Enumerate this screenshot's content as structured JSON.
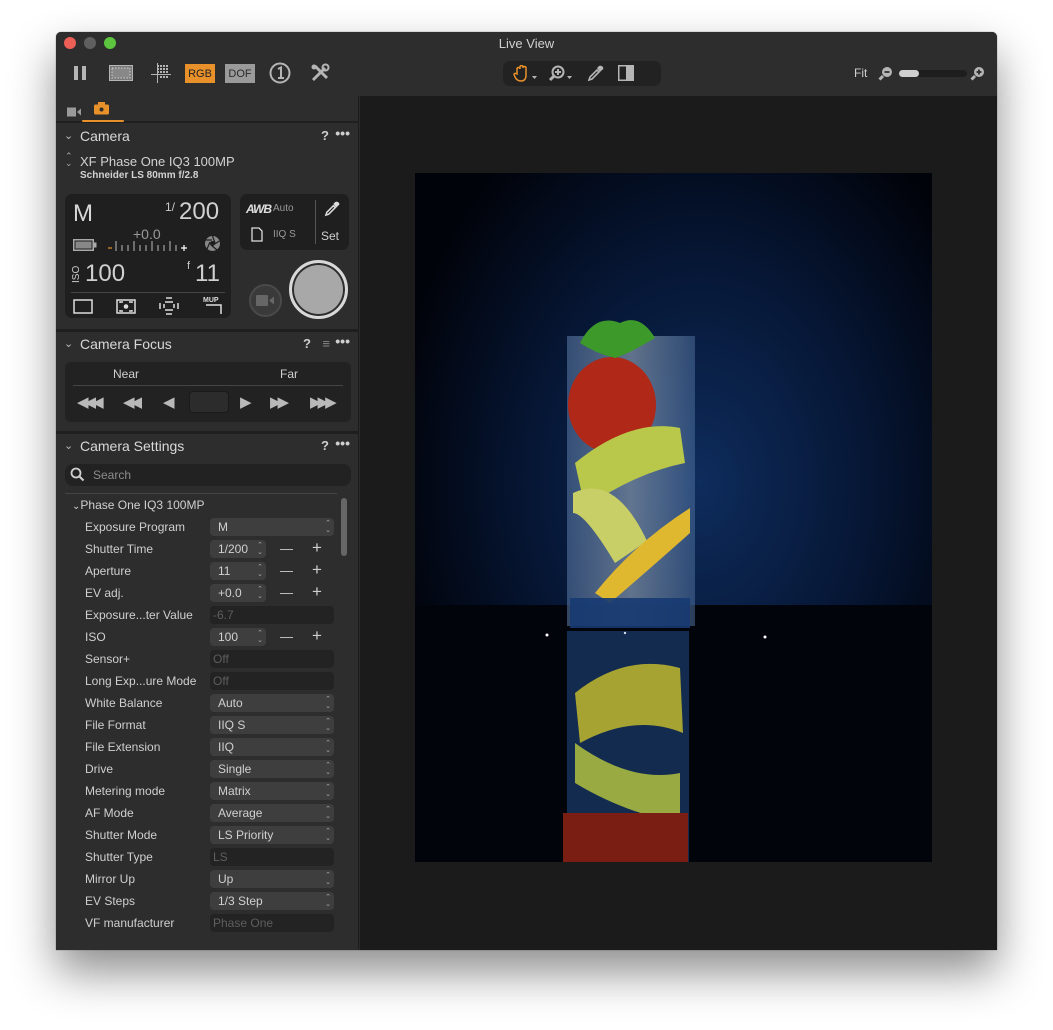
{
  "window": {
    "title": "Live View"
  },
  "toolbar": {
    "left_buttons": [
      {
        "name": "pause",
        "icon": "pause-icon"
      },
      {
        "name": "frame",
        "icon": "frame-overlay-icon"
      },
      {
        "name": "grid",
        "icon": "grid-icon"
      },
      {
        "name": "rgb",
        "label": "RGB"
      },
      {
        "name": "dof",
        "label": "DOF"
      },
      {
        "name": "one",
        "icon": "circled-one-icon"
      },
      {
        "name": "tools",
        "icon": "tools-icon"
      }
    ],
    "rgb_label": "RGB",
    "dof_label": "DOF",
    "center_tools": [
      "hand-icon",
      "zoom-in-icon",
      "eyedropper-icon",
      "compare-icon"
    ],
    "fit_label": "Fit",
    "zoom_level_fraction": 0.3
  },
  "colors": {
    "accent": "#e8912a",
    "panel": "#2d2d2d",
    "viewer": "#1b1b1b"
  },
  "tabs": [
    {
      "icon": "video-icon",
      "active": false
    },
    {
      "icon": "camera-icon",
      "active": true
    }
  ],
  "camera": {
    "section_title": "Camera",
    "help": "?",
    "more": "•••",
    "model": "XF Phase One IQ3 100MP",
    "lens": "Schneider LS 80mm f/2.8",
    "lcd": {
      "mode": "M",
      "shutter_prefix": "1/",
      "shutter": "200",
      "ev": "+0.0",
      "ev_minus": "–",
      "ev_plus": "+",
      "iso_label": "ISO",
      "iso": "100",
      "aperture_prefix": "f",
      "aperture": "11",
      "mup_label": "MUP"
    },
    "wb": {
      "awb_label": "AWB",
      "wb_value": "Auto",
      "file_format": "IIQ S",
      "set_label": "Set"
    }
  },
  "focus": {
    "section_title": "Camera Focus",
    "help": "?",
    "more": "•••",
    "near_label": "Near",
    "far_label": "Far",
    "buttons": [
      "◀◀◀",
      "◀◀",
      "◀",
      "▶",
      "▶▶",
      "▶▶▶"
    ]
  },
  "settings": {
    "section_title": "Camera Settings",
    "help": "?",
    "more": "•••",
    "search_placeholder": "Search",
    "group": "Phase One IQ3 100MP",
    "rows": [
      {
        "label": "Exposure Program",
        "value": "M",
        "type": "select"
      },
      {
        "label": "Shutter Time",
        "value": "1/200",
        "type": "stepper"
      },
      {
        "label": "Aperture",
        "value": "11",
        "type": "stepper"
      },
      {
        "label": "EV adj.",
        "value": "+0.0",
        "type": "stepper"
      },
      {
        "label": "Exposure...ter Value",
        "value": "-6.7",
        "type": "readonly"
      },
      {
        "label": "ISO",
        "value": "100",
        "type": "stepper"
      },
      {
        "label": "Sensor+",
        "value": "Off",
        "type": "readonly"
      },
      {
        "label": "Long Exp...ure Mode",
        "value": "Off",
        "type": "readonly"
      },
      {
        "label": "White Balance",
        "value": "Auto",
        "type": "select"
      },
      {
        "label": "File Format",
        "value": "IIQ S",
        "type": "select"
      },
      {
        "label": "File Extension",
        "value": "IIQ",
        "type": "select"
      },
      {
        "label": "Drive",
        "value": "Single",
        "type": "select"
      },
      {
        "label": "Metering mode",
        "value": "Matrix",
        "type": "select"
      },
      {
        "label": "AF Mode",
        "value": "Average",
        "type": "select"
      },
      {
        "label": "Shutter Mode",
        "value": "LS Priority",
        "type": "select"
      },
      {
        "label": "Shutter Type",
        "value": "LS",
        "type": "readonly"
      },
      {
        "label": "Mirror Up",
        "value": "Up",
        "type": "select"
      },
      {
        "label": "EV Steps",
        "value": "1/3 Step",
        "type": "select"
      },
      {
        "label": "VF manufacturer",
        "value": "Phase One",
        "type": "readonly"
      }
    ]
  },
  "viewer": {
    "image_description": "Tall glass with strawberry, lime and lemon slices in sparkling water on a reflective black surface against a dark blue background"
  }
}
